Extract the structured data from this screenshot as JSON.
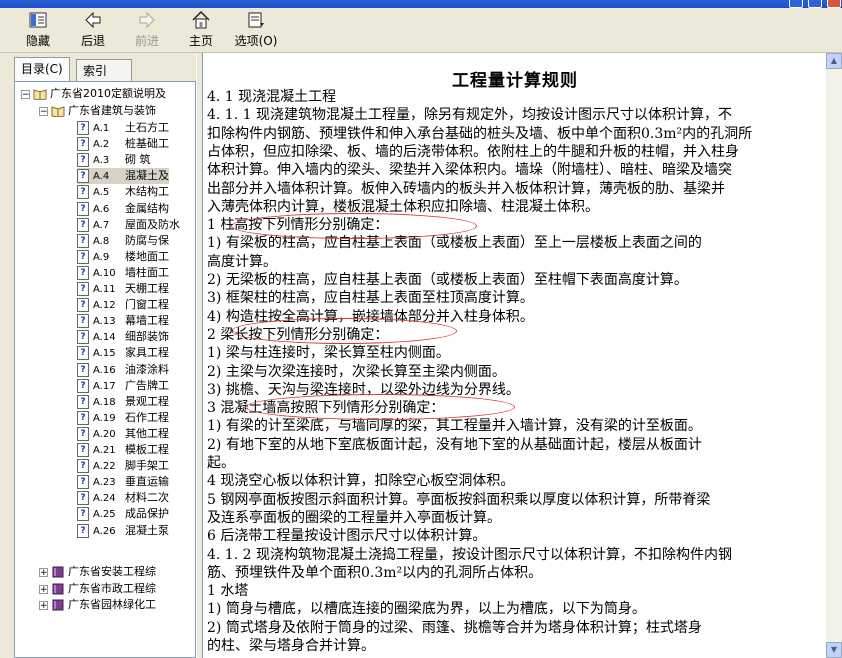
{
  "toolbar": {
    "hide": "隐藏",
    "back": "后退",
    "forward": "前进",
    "home": "主页",
    "options": "选项(O)"
  },
  "tabs": {
    "contents": "目录(C)",
    "index": "索引(N)"
  },
  "tree": {
    "root": "广东省2010定额说明及",
    "sub1": "广东省建筑与装饰",
    "items": [
      {
        "code": "A.1",
        "label": "土石方工"
      },
      {
        "code": "A.2",
        "label": "桩基础工"
      },
      {
        "code": "A.3",
        "label": "砌  筑"
      },
      {
        "code": "A.4",
        "label": "混凝土及"
      },
      {
        "code": "A.5",
        "label": "木结构工"
      },
      {
        "code": "A.6",
        "label": "金属结构"
      },
      {
        "code": "A.7",
        "label": "屋面及防水"
      },
      {
        "code": "A.8",
        "label": "防腐与保"
      },
      {
        "code": "A.9",
        "label": "楼地面工"
      },
      {
        "code": "A.10",
        "label": "墙柱面工"
      },
      {
        "code": "A.11",
        "label": "天棚工程"
      },
      {
        "code": "A.12",
        "label": "门窗工程"
      },
      {
        "code": "A.13",
        "label": "幕墙工程"
      },
      {
        "code": "A.14",
        "label": "细部装饰"
      },
      {
        "code": "A.15",
        "label": "家具工程"
      },
      {
        "code": "A.16",
        "label": "油漆涂料"
      },
      {
        "code": "A.17",
        "label": "广告牌工"
      },
      {
        "code": "A.18",
        "label": "景观工程"
      },
      {
        "code": "A.19",
        "label": "石作工程"
      },
      {
        "code": "A.20",
        "label": "其他工程"
      },
      {
        "code": "A.21",
        "label": "模板工程"
      },
      {
        "code": "A.22",
        "label": "脚手架工"
      },
      {
        "code": "A.23",
        "label": "垂直运输"
      },
      {
        "code": "A.24",
        "label": "材料二次"
      },
      {
        "code": "A.25",
        "label": "成品保护"
      },
      {
        "code": "A.26",
        "label": "混凝土泵"
      }
    ],
    "others": [
      "广东省安装工程综",
      "广东省市政工程综",
      "广东省园林绿化工"
    ]
  },
  "doc": {
    "title": "工程量计算规则",
    "lines": [
      "4. 1  现浇混凝土工程",
      "4. 1. 1  现浇建筑物混凝土工程量，除另有规定外，均按设计图示尺寸以体积计算，不",
      "扣除构件内钢筋、预埋铁件和伸入承台基础的桩头及墙、板中单个面积0.3m²内的孔洞所",
      "占体积，但应扣除梁、板、墙的后浇带体积。依附柱上的牛腿和升板的柱帽，并入柱身",
      "体积计算。伸入墙内的梁头、梁垫并入梁体积内。墙垛（附墙柱）、暗柱、暗梁及墙突",
      "出部分并入墙体积计算。板伸入砖墙内的板头并入板体积计算，薄壳板的肋、基梁并",
      "入薄壳体积内计算，楼板混凝土体积应扣除墙、柱混凝土体积。",
      "   1  柱高按下列情形分别确定：",
      "   1)   有梁板的柱高，应自柱基上表面（或楼板上表面）至上一层楼板上表面之间的",
      "高度计算。",
      "   2)   无梁板的柱高，应自柱基上表面（或楼板上表面）至柱帽下表面高度计算。",
      "   3)   框架柱的柱高，应自柱基上表面至柱顶高度计算。",
      "   4)   构造柱按全高计算，嵌接墙体部分并入柱身体积。",
      "   2  梁长按下列情形分别确定：",
      "   1)   梁与柱连接时，梁长算至柱内侧面。",
      "   2)   主梁与次梁连接时，次梁长算至主梁内侧面。",
      "   3)   挑檐、天沟与梁连接时，以梁外边线为分界线。",
      "   3  混凝土墙高按照下列情形分别确定：",
      "   1)   有梁的计至梁底，与墙同厚的梁，其工程量并入墙计算，没有梁的计至板面。",
      "   2)   有地下室的从地下室底板面计起，没有地下室的从基础面计起，楼层从板面计",
      "起。",
      "   4  现浇空心板以体积计算，扣除空心板空洞体积。",
      "   5  钢网亭面板按图示斜面积计算。亭面板按斜面积乘以厚度以体积计算，所带脊梁",
      "及连系亭面板的圈梁的工程量并入亭面板计算。",
      "   6  后浇带工程量按设计图示尺寸以体积计算。",
      "4. 1. 2  现浇构筑物混凝土浇捣工程量，按设计图示尺寸以体积计算，不扣除构件内钢",
      "筋、预埋铁件及单个面积0.3m²以内的孔洞所占体积。",
      "   1  水塔",
      "   1)   筒身与槽底，以槽底连接的圈梁底为界，以上为槽底，以下为筒身。",
      "   2)   筒式塔身及依附于筒身的过梁、雨篷、挑檐等合并为塔身体积计算；柱式塔身",
      "的柱、梁与塔身合并计算。"
    ]
  },
  "colors": {
    "accent": "#2a5fd6",
    "annotation": "#d23b3b"
  }
}
